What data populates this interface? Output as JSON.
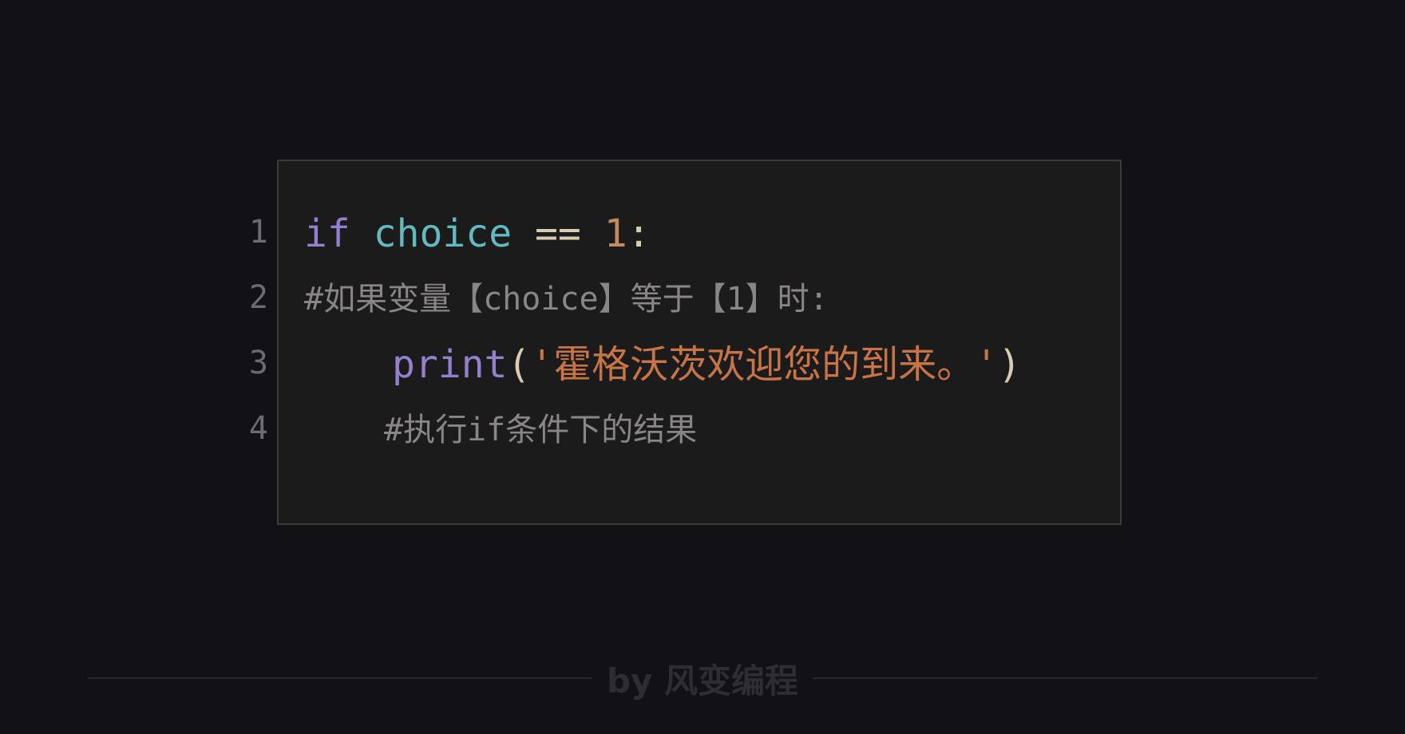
{
  "editor": {
    "line_numbers": [
      "1",
      "2",
      "3",
      "4"
    ],
    "lines": [
      {
        "tokens": [
          {
            "text": "if",
            "kind": "keyword"
          },
          {
            "text": " ",
            "kind": "space"
          },
          {
            "text": "choice",
            "kind": "identifier"
          },
          {
            "text": " ",
            "kind": "space"
          },
          {
            "text": "==",
            "kind": "operator"
          },
          {
            "text": " ",
            "kind": "space"
          },
          {
            "text": "1",
            "kind": "number"
          },
          {
            "text": ":",
            "kind": "punctuation"
          }
        ]
      },
      {
        "tokens": [
          {
            "text": "#如果变量【choice】等于【1】时:",
            "kind": "comment"
          }
        ]
      },
      {
        "tokens": [
          {
            "text": "print",
            "kind": "function"
          },
          {
            "text": "(",
            "kind": "punctuation"
          },
          {
            "text": "'霍格沃茨欢迎您的到来。'",
            "kind": "string"
          },
          {
            "text": ")",
            "kind": "punctuation"
          }
        ]
      },
      {
        "tokens": [
          {
            "text": "#执行if条件下的结果",
            "kind": "comment"
          }
        ]
      }
    ]
  },
  "footer": {
    "credit": "by 风变编程"
  },
  "colors": {
    "background": "#111116",
    "editor_background": "#1b1b1b",
    "editor_border": "#3b3b3b",
    "keyword": "#9480cf",
    "identifier": "#62b9c1",
    "number": "#c48a5c",
    "string": "#c87446",
    "comment": "#8a8687",
    "operator": "#d8ccb4",
    "line_number": "#6d6b72",
    "footer_text": "#2d2d33"
  }
}
